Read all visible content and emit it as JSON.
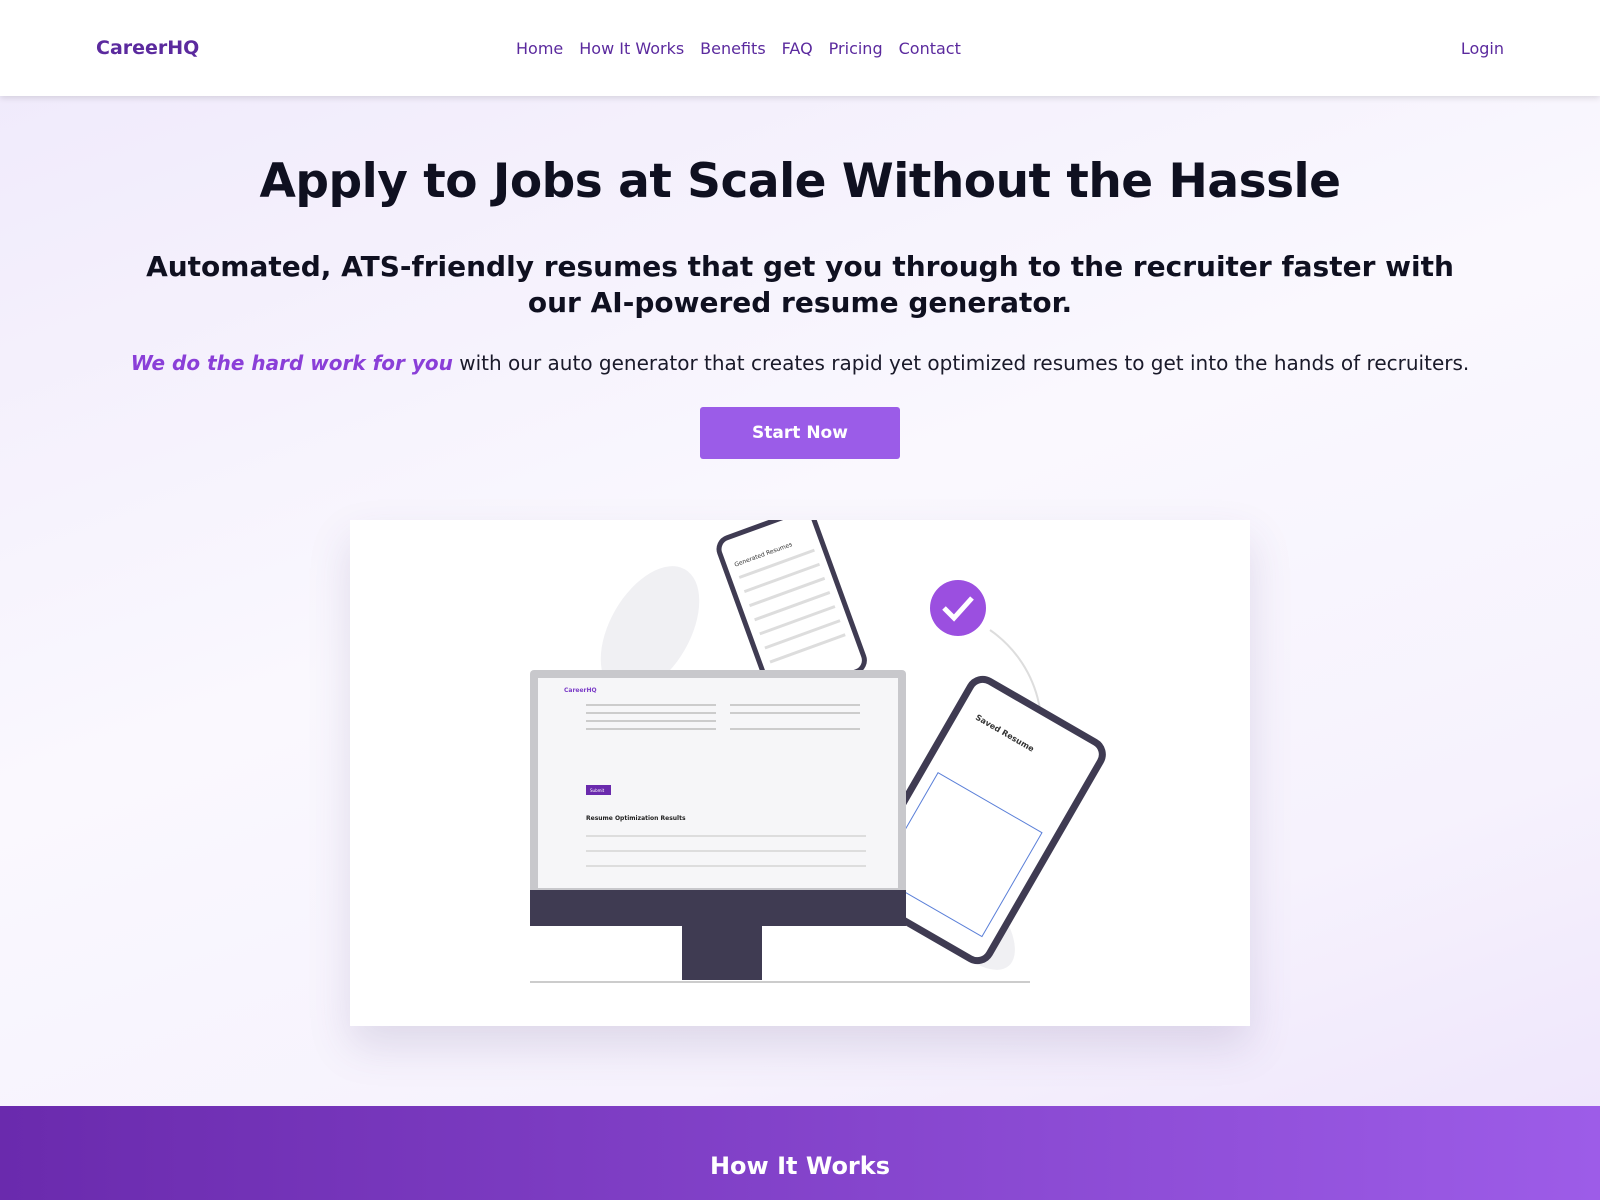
{
  "header": {
    "logo": "CareerHQ",
    "nav": [
      "Home",
      "How It Works",
      "Benefits",
      "FAQ",
      "Pricing",
      "Contact"
    ],
    "login": "Login"
  },
  "hero": {
    "title": "Apply to Jobs at Scale Without the Hassle",
    "subtitle": "Automated, ATS-friendly resumes that get you through to the recruiter faster with our AI-powered resume generator.",
    "desc_highlight": "We do the hard work for you",
    "desc_rest": " with our auto generator that creates rapid yet optimized resumes to get into the hands of recruiters.",
    "cta": "Start Now"
  },
  "illustration": {
    "desktop_logo": "CareerHQ",
    "desktop_section": "Resume Optimization Results",
    "desktop_submit": "Submit",
    "tablet_title": "Saved Resume",
    "phone_title": "Generated Resumes"
  },
  "section": {
    "title": "How It Works"
  },
  "colors": {
    "brand": "#5b2a9e",
    "accent": "#9b5ce8"
  }
}
